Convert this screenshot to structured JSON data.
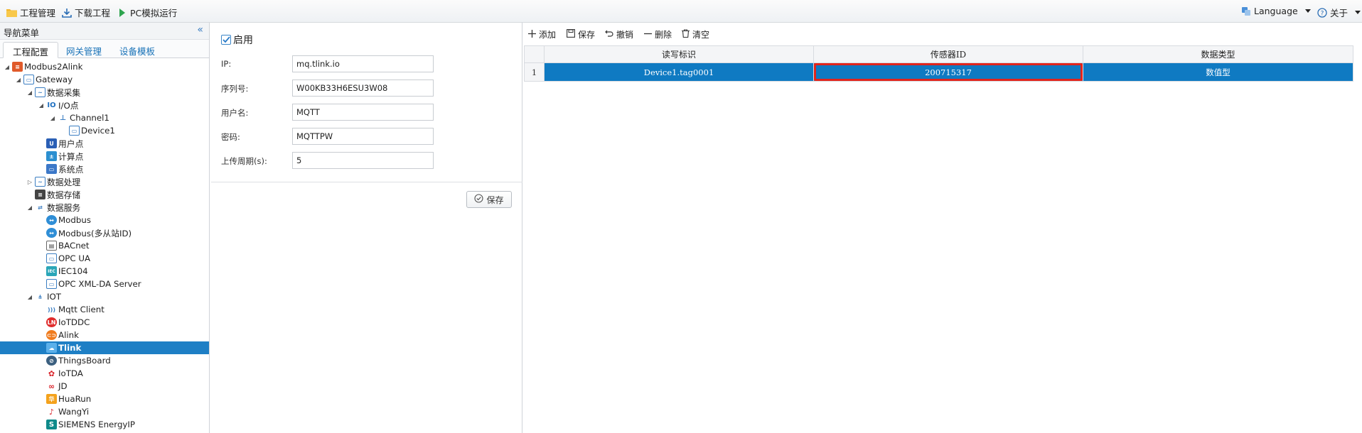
{
  "topbar": {
    "project_mgmt": "工程管理",
    "download_project": "下载工程",
    "pc_simulate": "PC模拟运行",
    "language": "Language",
    "about": "关于"
  },
  "sidebar": {
    "title": "导航菜单",
    "collapse_glyph": "«",
    "tabs": [
      "工程配置",
      "网关管理",
      "设备模板"
    ],
    "tree": {
      "root": "Modbus2Alink",
      "gateway": "Gateway",
      "data_collect": "数据采集",
      "io_points": "I/O点",
      "channel1": "Channel1",
      "device1": "Device1",
      "user_points": "用户点",
      "calc_points": "计算点",
      "system_points": "系统点",
      "data_process": "数据处理",
      "data_storage": "数据存储",
      "data_service": "数据服务",
      "modbus": "Modbus",
      "modbus_multi": "Modbus(多从站ID)",
      "bacnet": "BACnet",
      "opc_ua": "OPC UA",
      "iec104": "IEC104",
      "opc_xml": "OPC XML-DA Server",
      "iot": "IOT",
      "mqtt_client": "Mqtt Client",
      "iotddc": "IoTDDC",
      "alink": "Alink",
      "tlink": "Tlink",
      "thingsboard": "ThingsBoard",
      "iotda": "IoTDA",
      "jd": "JD",
      "huarun": "HuaRun",
      "wangyi": "WangYi",
      "siemens": "SIEMENS EnergyIP"
    }
  },
  "form": {
    "enable_label": "启用",
    "enabled": true,
    "fields": [
      {
        "label": "IP:",
        "value": "mq.tlink.io"
      },
      {
        "label": "序列号:",
        "value": "W00KB33H6ESU3W08"
      },
      {
        "label": "用户名:",
        "value": "MQTT"
      },
      {
        "label": "密码:",
        "value": "MQTTPW"
      },
      {
        "label": "上传周期(s):",
        "value": "5"
      }
    ],
    "save_label": "保存"
  },
  "grid": {
    "toolbar": {
      "add": "添加",
      "save": "保存",
      "undo": "撤销",
      "delete": "删除",
      "clear": "清空"
    },
    "columns": [
      "读写标识",
      "传感器ID",
      "数据类型"
    ],
    "rows": [
      {
        "index": "1",
        "tag": "Device1.tag0001",
        "sensor_id": "200715317",
        "data_type": "数值型"
      }
    ]
  },
  "colors": {
    "accent": "#1e7fc5",
    "selected_row": "#0f7ac2",
    "highlight_box": "#e2241b"
  }
}
